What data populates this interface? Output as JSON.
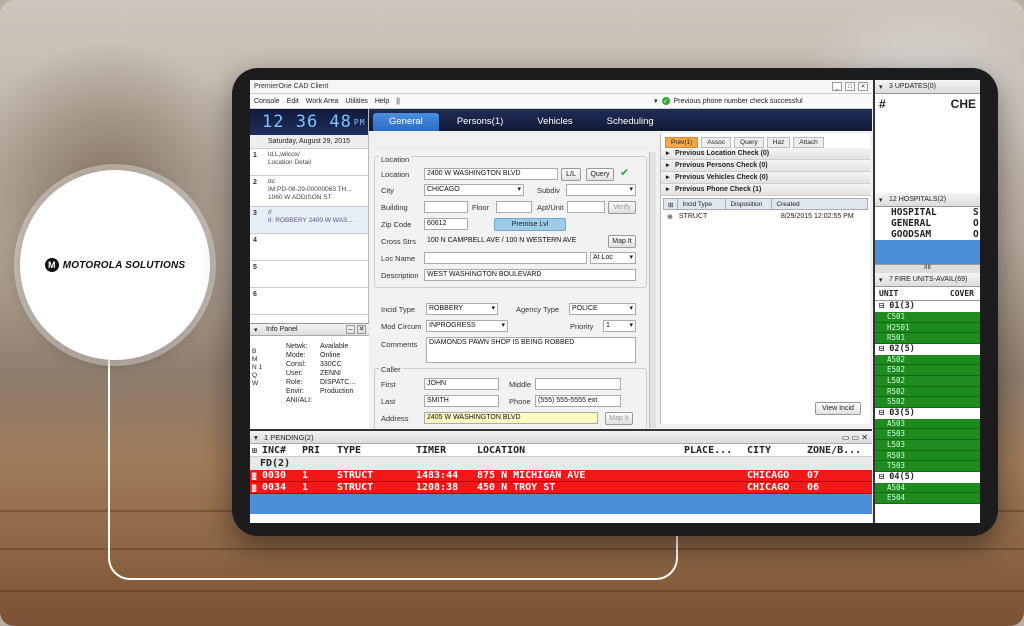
{
  "brand": {
    "logo_letter": "M",
    "name": "MOTOROLA SOLUTIONS"
  },
  "window": {
    "title": "PremierOne CAD Client",
    "btns": [
      "_",
      "□",
      "✕"
    ]
  },
  "menu": {
    "items": [
      "Console",
      "Edit",
      "Work Area",
      "Utilities",
      "Help",
      "||"
    ],
    "status": "Previous phone number check successful"
  },
  "clock": {
    "time": "12 36 48",
    "ampm": "PM",
    "date": "Saturday, August 29, 2015"
  },
  "slots": [
    {
      "num": "1",
      "line1": "ld,L,wilcox/",
      "line2": "Location Detail"
    },
    {
      "num": "2",
      "line1": "dc",
      "line2": "IM:PD-08-29-00000063   TH...",
      "line3": "1060 W ADDISON ST"
    },
    {
      "num": "3",
      "line1": "//",
      "line2": "II: ROBBERY   2400 W WAS..."
    },
    {
      "num": "4"
    },
    {
      "num": "5"
    },
    {
      "num": "6"
    }
  ],
  "info_panel": {
    "title": "Info Panel",
    "side": [
      "B",
      "M",
      "N  1",
      "Q",
      "W"
    ],
    "rows": [
      [
        "Netwk:",
        "Available"
      ],
      [
        "Mode:",
        "Online"
      ],
      [
        "Consl:",
        "330CC"
      ],
      [
        "User:",
        "ZENNI"
      ],
      [
        "Role:",
        "DISPATC..."
      ],
      [
        "Envir:",
        "Production"
      ],
      [
        "",
        ""
      ],
      [
        "ANI/ALI:",
        ""
      ]
    ]
  },
  "tabs": [
    "General",
    "Persons(1)",
    "Vehicles",
    "Scheduling"
  ],
  "form": {
    "location_group": "Location",
    "location_label": "Location",
    "location": "2400 W WASHINGTON BLVD",
    "ll_btn": "L/L",
    "query_btn": "Query",
    "city_label": "City",
    "city": "CHICAGO",
    "subdiv_label": "Subdiv",
    "building_label": "Building",
    "floor_label": "Floor",
    "apt_label": "Apt/Unit",
    "verify_btn": "Verify",
    "zip_label": "Zip Code",
    "zip": "60612",
    "premise_btn": "Premise Lvl",
    "cross_label": "Cross Strs",
    "cross": "100 N CAMPBELL AVE / 100 N WESTERN AVE",
    "map_btn": "Map It",
    "locname_label": "Loc Name",
    "atloc": "At Loc",
    "desc_label": "Description",
    "desc": "WEST WASHINGTON BOULEVARD",
    "incid_label": "Incid Type",
    "incid": "ROBBERY",
    "agency_label": "Agency Type",
    "agency": "POLICE",
    "mod_label": "Mod Circum",
    "mod": "INPROGRESS",
    "priority_label": "Priority",
    "priority": "1",
    "comments_label": "Comments",
    "comments": "DIAMONDS PAWN SHOP IS BEING ROBBED",
    "caller_group": "Caller",
    "first_label": "First",
    "first": "JOHN",
    "middle_label": "Middle",
    "last_label": "Last",
    "last": "SMITH",
    "phone_label": "Phone",
    "phone": "(555) 555-5555 ext",
    "address_label": "Address",
    "address": "2405 W WASHINGTON BLVD",
    "map_btn2": "Map It"
  },
  "right": {
    "tabs": [
      "Prev(1)",
      "Assoc",
      "Query",
      "Haz",
      "Attach"
    ],
    "checks": [
      "Previous Location Check (0)",
      "Previous Persons Check (0)",
      "Previous Vehicles Check (0)",
      "Previous Phone Check (1)"
    ],
    "sub_cols": [
      "Incid Type",
      "Disposition",
      "Created"
    ],
    "sub_row": {
      "type": "STRUCT",
      "created": "8/29/2015 12:02:55 PM"
    },
    "view_btn": "View Incid"
  },
  "far": {
    "updates": "3 UPDATES(0)",
    "col1": "#",
    "col2": "CHE",
    "hospitals": "12 HOSPITALS(2)",
    "hosp_rows": [
      [
        "HOSPITAL",
        "S"
      ],
      [
        "GENERAL",
        "O"
      ],
      [
        "GOODSAM",
        "O"
      ]
    ],
    "scroll": "IIII",
    "fire": "7 FIRE UNITS-AVAIL(69)",
    "unit_col": "UNIT",
    "cover_col": "COVER",
    "groups": [
      {
        "name": "01(3)",
        "units": [
          "C501",
          "H2501",
          "R501"
        ]
      },
      {
        "name": "02(5)",
        "units": [
          "A502",
          "E502",
          "L502",
          "R502",
          "S502"
        ]
      },
      {
        "name": "03(5)",
        "units": [
          "A503",
          "E503",
          "L503",
          "R503",
          "T503"
        ]
      },
      {
        "name": "04(5)",
        "units": [
          "A504",
          "E504"
        ]
      }
    ]
  },
  "pending": {
    "title": "1 PENDING(2)",
    "cols": [
      "INC#",
      "PRI",
      "TYPE",
      "TIMER",
      "LOCATION",
      "PLACE...",
      "CITY",
      "ZONE/B..."
    ],
    "group": "FD(2)",
    "rows": [
      {
        "inc": "0030",
        "pri": "1",
        "type": "STRUCT",
        "timer": "1483:44",
        "loc": "875 N MICHIGAN AVE",
        "city": "CHICAGO",
        "zone": "07"
      },
      {
        "inc": "0034",
        "pri": "1",
        "type": "STRUCT",
        "timer": "1208:38",
        "loc": "450 N TROY ST",
        "city": "CHICAGO",
        "zone": "06"
      }
    ]
  }
}
